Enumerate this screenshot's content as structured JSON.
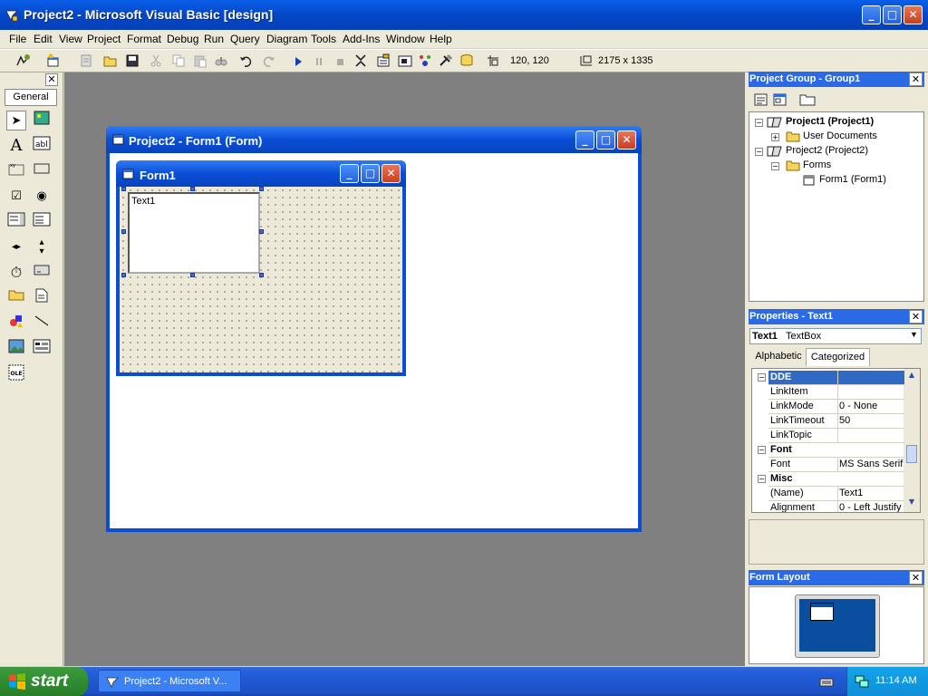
{
  "window": {
    "title": "Project2 - Microsoft Visual Basic [design]"
  },
  "menu": [
    "File",
    "Edit",
    "View",
    "Project",
    "Format",
    "Debug",
    "Run",
    "Query",
    "Diagram",
    "Tools",
    "Add-Ins",
    "Window",
    "Help"
  ],
  "toolbar": {
    "position": "120, 120",
    "size": "2175 x 1335"
  },
  "toolbox": {
    "tab": "General"
  },
  "project_window": {
    "title": "Project2 - Form1 (Form)"
  },
  "form": {
    "title": "Form1",
    "textbox_text": "Text1"
  },
  "project_group": {
    "title": "Project Group - Group1",
    "tree": [
      {
        "label": "Project1 (Project1)",
        "bold": true
      },
      {
        "label": "User Documents"
      },
      {
        "label": "Project2 (Project2)"
      },
      {
        "label": "Forms"
      },
      {
        "label": "Form1 (Form1)"
      }
    ]
  },
  "properties": {
    "title": "Properties - Text1",
    "object_name": "Text1",
    "object_type": "TextBox",
    "tabs": [
      "Alphabetic",
      "Categorized"
    ],
    "active_tab": "Categorized",
    "rows": [
      {
        "name": "DDE",
        "value": "",
        "category": true
      },
      {
        "name": "LinkItem",
        "value": ""
      },
      {
        "name": "LinkMode",
        "value": "0 - None"
      },
      {
        "name": "LinkTimeout",
        "value": "50"
      },
      {
        "name": "LinkTopic",
        "value": ""
      },
      {
        "name": "Font",
        "value": "",
        "category": true
      },
      {
        "name": "Font",
        "value": "MS Sans Serif"
      },
      {
        "name": "Misc",
        "value": "",
        "category": true
      },
      {
        "name": "(Name)",
        "value": "Text1"
      },
      {
        "name": "Alignment",
        "value": "0 - Left Justify"
      }
    ]
  },
  "form_layout": {
    "title": "Form Layout"
  },
  "taskbar": {
    "start": "start",
    "task": "Project2 - Microsoft V...",
    "clock": "11:14 AM"
  },
  "colors": {
    "title_blue": "#0a4ed6",
    "mdi_gray": "#808080",
    "pane_blue": "#2a6ae5"
  }
}
